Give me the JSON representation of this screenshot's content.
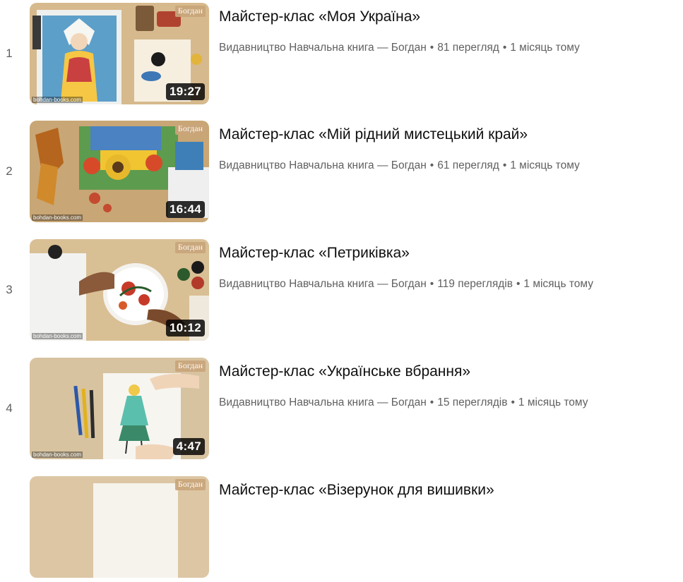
{
  "playlist": {
    "items": [
      {
        "index": "1",
        "title": "Майстер-клас «Моя Україна»",
        "channel": "Видавництво Навчальна книга — Богдан",
        "views": "81 перегляд",
        "age": "1 місяць тому",
        "duration": "19:27",
        "thumb_icon": "painting-woman-thumbnail",
        "logo": "Богдан",
        "watermark": "bohdan-books.com"
      },
      {
        "index": "2",
        "title": "Майстер-клас «Мій рідний мистецький край»",
        "channel": "Видавництво Навчальна книга — Богдан",
        "views": "61 перегляд",
        "age": "1 місяць тому",
        "duration": "16:44",
        "thumb_icon": "sunflower-collage-thumbnail",
        "logo": "Богдан",
        "watermark": "bohdan-books.com"
      },
      {
        "index": "3",
        "title": "Майстер-клас «Петриківка»",
        "channel": "Видавництво Навчальна книга — Богдан",
        "views": "119 переглядів",
        "age": "1 місяць тому",
        "duration": "10:12",
        "thumb_icon": "petrykivka-plate-thumbnail",
        "logo": "Богдан",
        "watermark": "bohdan-books.com"
      },
      {
        "index": "4",
        "title": "Майстер-клас «Українське вбрання»",
        "channel": "Видавництво Навчальна книга — Богдан",
        "views": "15 переглядів",
        "age": "1 місяць тому",
        "duration": "4:47",
        "thumb_icon": "costume-drawing-thumbnail",
        "logo": "Богдан",
        "watermark": "bohdan-books.com"
      },
      {
        "index": "",
        "title": "Майстер-клас «Візерунок для вишивки»",
        "channel": "",
        "views": "",
        "age": "",
        "duration": "",
        "thumb_icon": "embroidery-pattern-thumbnail",
        "logo": "Богдан",
        "watermark": ""
      }
    ],
    "separator": "•"
  }
}
